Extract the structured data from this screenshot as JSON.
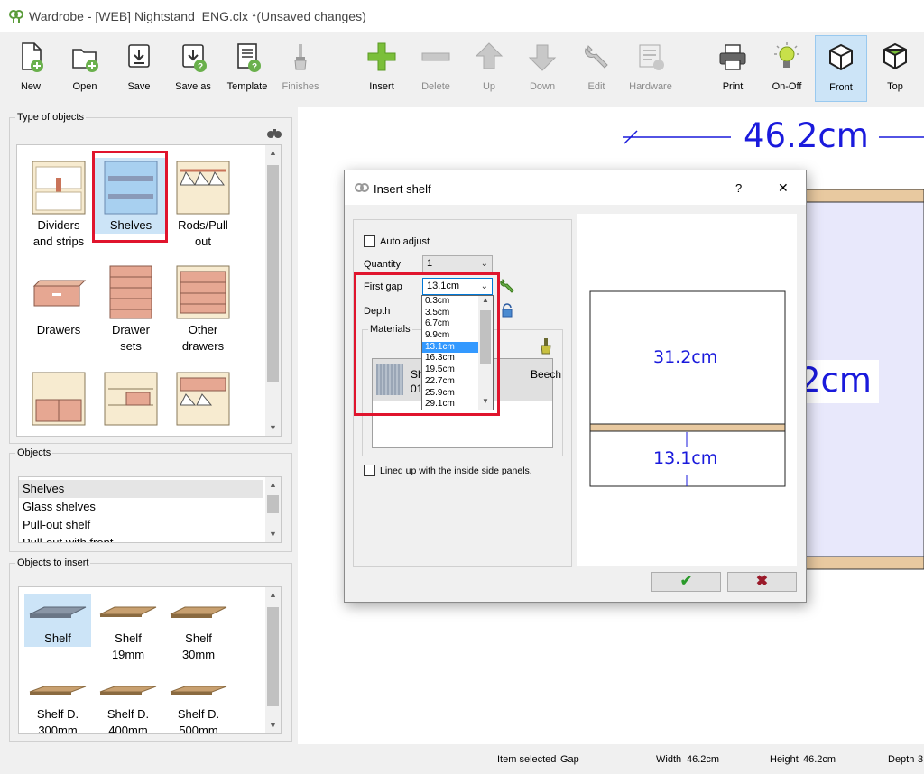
{
  "window": {
    "title": "Wardrobe - [WEB] Nightstand_ENG.clx *(Unsaved changes)"
  },
  "toolbar": {
    "new": "New",
    "open": "Open",
    "save": "Save",
    "save_as": "Save as",
    "template": "Template",
    "finishes": "Finishes",
    "insert": "Insert",
    "delete": "Delete",
    "up": "Up",
    "down": "Down",
    "edit": "Edit",
    "hardware": "Hardware",
    "print": "Print",
    "on_off": "On-Off",
    "front": "Front",
    "top": "Top"
  },
  "type_panel": {
    "legend": "Type of objects",
    "tiles": [
      {
        "label": "Dividers\nand strips"
      },
      {
        "label": "Shelves"
      },
      {
        "label": "Rods/Pull\nout"
      },
      {
        "label": "Drawers"
      },
      {
        "label": "Drawer\nsets"
      },
      {
        "label": "Other\ndrawers"
      }
    ]
  },
  "objects_panel": {
    "legend": "Objects",
    "items": [
      "Shelves",
      "Glass shelves",
      "Pull-out shelf",
      "Pull-out with front"
    ]
  },
  "insert_panel": {
    "legend": "Objects to insert",
    "tiles": [
      {
        "label": "Shelf"
      },
      {
        "label": "Shelf\n19mm"
      },
      {
        "label": "Shelf\n30mm"
      },
      {
        "label": "Shelf D.\n300mm"
      },
      {
        "label": "Shelf D.\n400mm"
      },
      {
        "label": "Shelf D.\n500mm"
      }
    ]
  },
  "canvas": {
    "dim_top": "46.2cm",
    "dim_side": "2cm"
  },
  "status": {
    "item_label": "Item selected",
    "item_value": "Gap",
    "width_label": "Width",
    "width_value": "46.2cm",
    "height_label": "Height",
    "height_value": "46.2cm",
    "depth_label": "Depth",
    "depth_value": "3"
  },
  "dialog": {
    "title": "Insert shelf",
    "help": "?",
    "close": "✕",
    "auto_adjust": "Auto adjust",
    "quantity_label": "Quantity",
    "quantity_value": "1",
    "first_gap_label": "First gap",
    "first_gap_value": "13.1cm",
    "depth_label": "Depth",
    "materials_legend": "Materials",
    "material_name_1": "Shel",
    "material_name_2": "01",
    "material_value": "Beech",
    "lined_up": "Lined up with the inside side panels.",
    "gap_options": [
      "0.3cm",
      "3.5cm",
      "6.7cm",
      "9.9cm",
      "13.1cm",
      "16.3cm",
      "19.5cm",
      "22.7cm",
      "25.9cm",
      "29.1cm"
    ],
    "selected_option": "13.1cm",
    "preview_top": "31.2cm",
    "preview_bottom": "13.1cm",
    "ok": "✔",
    "cancel": "✖"
  },
  "colors": {
    "accent_blue": "#1a1adc",
    "highlight_red": "#e0142d",
    "selection_blue": "#3399ff",
    "wood": "#e8c9a0"
  }
}
